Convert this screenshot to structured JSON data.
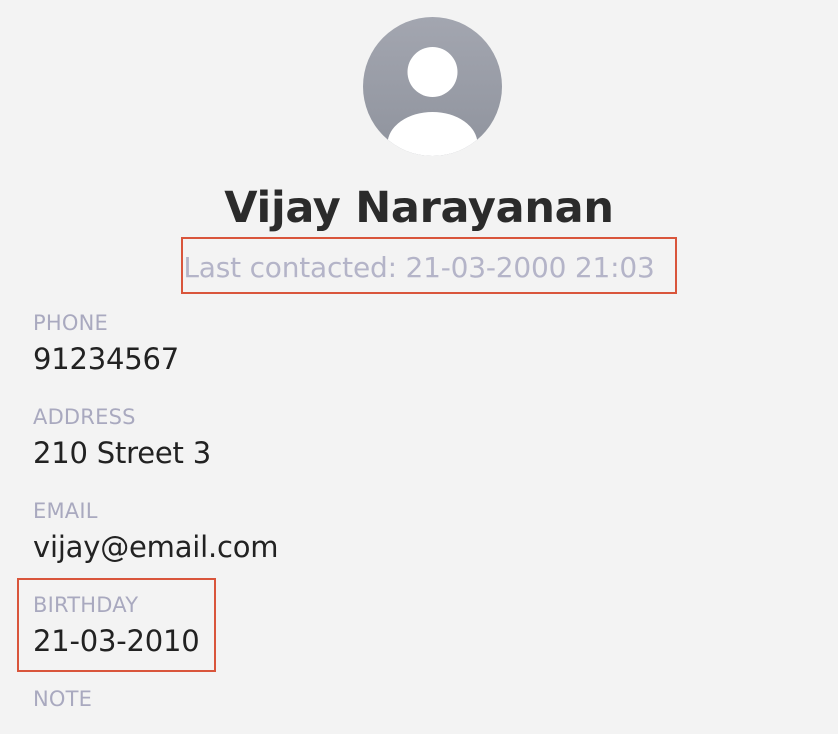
{
  "contact": {
    "name": "Vijay Narayanan",
    "last_contacted": "Last contacted: 21-03-2000 21:03",
    "avatar_icon": "person-silhouette-icon"
  },
  "fields": {
    "phone": {
      "label": "PHONE",
      "value": "91234567"
    },
    "address": {
      "label": "ADDRESS",
      "value": "210 Street 3"
    },
    "email": {
      "label": "EMAIL",
      "value": "vijay@email.com"
    },
    "birthday": {
      "label": "BIRTHDAY",
      "value": "21-03-2010"
    },
    "note": {
      "label": "NOTE",
      "value": ""
    }
  },
  "colors": {
    "background": "#f3f3f3",
    "avatar": "#9ea2ad",
    "label": "#a9a9bf",
    "highlight": "#d9553b",
    "text": "#222222"
  }
}
